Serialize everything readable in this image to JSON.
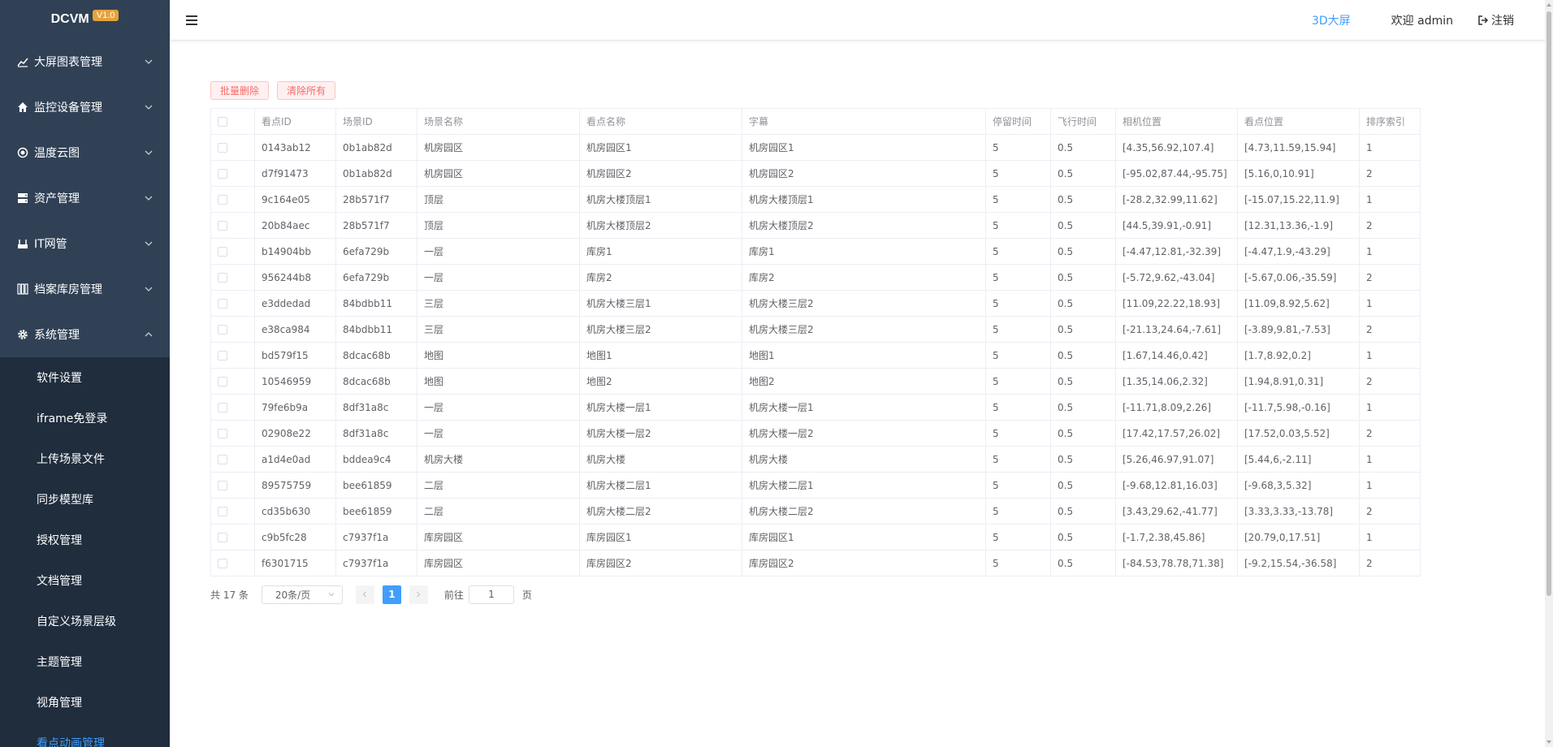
{
  "app": {
    "name": "DCVM",
    "version": "V1.0"
  },
  "sidebar": {
    "menus": [
      {
        "label": "大屏图表管理",
        "icon": "chart-line-icon"
      },
      {
        "label": "监控设备管理",
        "icon": "home-icon"
      },
      {
        "label": "温度云图",
        "icon": "thermometer-icon"
      },
      {
        "label": "资产管理",
        "icon": "server-icon"
      },
      {
        "label": "IT网管",
        "icon": "network-icon"
      },
      {
        "label": "档案库房管理",
        "icon": "archive-icon"
      },
      {
        "label": "系统管理",
        "icon": "gear-icon"
      }
    ],
    "sub_items": [
      {
        "label": "软件设置"
      },
      {
        "label": "iframe免登录"
      },
      {
        "label": "上传场景文件"
      },
      {
        "label": "同步模型库"
      },
      {
        "label": "授权管理"
      },
      {
        "label": "文档管理"
      },
      {
        "label": "自定义场景层级"
      },
      {
        "label": "主题管理"
      },
      {
        "label": "视角管理"
      },
      {
        "label": "看点动画管理"
      }
    ]
  },
  "header": {
    "screen_link": "3D大屏",
    "welcome": "欢迎 admin",
    "logout": "注销"
  },
  "toolbar": {
    "batch_delete": "批量删除",
    "clear_all": "清除所有"
  },
  "table": {
    "columns": [
      "看点ID",
      "场景ID",
      "场景名称",
      "看点名称",
      "字幕",
      "停留时间",
      "飞行时间",
      "相机位置",
      "看点位置",
      "排序索引"
    ],
    "rows": [
      [
        "0143ab12",
        "0b1ab82d",
        "机房园区",
        "机房园区1",
        "机房园区1",
        "5",
        "0.5",
        "[4.35,56.92,107.4]",
        "[4.73,11.59,15.94]",
        "1"
      ],
      [
        "d7f91473",
        "0b1ab82d",
        "机房园区",
        "机房园区2",
        "机房园区2",
        "5",
        "0.5",
        "[-95.02,87.44,-95.75]",
        "[5.16,0,10.91]",
        "2"
      ],
      [
        "9c164e05",
        "28b571f7",
        "顶层",
        "机房大楼顶层1",
        "机房大楼顶层1",
        "5",
        "0.5",
        "[-28.2,32.99,11.62]",
        "[-15.07,15.22,11.9]",
        "1"
      ],
      [
        "20b84aec",
        "28b571f7",
        "顶层",
        "机房大楼顶层2",
        "机房大楼顶层2",
        "5",
        "0.5",
        "[44.5,39.91,-0.91]",
        "[12.31,13.36,-1.9]",
        "2"
      ],
      [
        "b14904bb",
        "6efa729b",
        "一层",
        "库房1",
        "库房1",
        "5",
        "0.5",
        "[-4.47,12.81,-32.39]",
        "[-4.47,1.9,-43.29]",
        "1"
      ],
      [
        "956244b8",
        "6efa729b",
        "一层",
        "库房2",
        "库房2",
        "5",
        "0.5",
        "[-5.72,9.62,-43.04]",
        "[-5.67,0.06,-35.59]",
        "2"
      ],
      [
        "e3ddedad",
        "84bdbb11",
        "三层",
        "机房大楼三层1",
        "机房大楼三层2",
        "5",
        "0.5",
        "[11.09,22.22,18.93]",
        "[11.09,8.92,5.62]",
        "1"
      ],
      [
        "e38ca984",
        "84bdbb11",
        "三层",
        "机房大楼三层2",
        "机房大楼三层2",
        "5",
        "0.5",
        "[-21.13,24.64,-7.61]",
        "[-3.89,9.81,-7.53]",
        "2"
      ],
      [
        "bd579f15",
        "8dcac68b",
        "地图",
        "地图1",
        "地图1",
        "5",
        "0.5",
        "[1.67,14.46,0.42]",
        "[1.7,8.92,0.2]",
        "1"
      ],
      [
        "10546959",
        "8dcac68b",
        "地图",
        "地图2",
        "地图2",
        "5",
        "0.5",
        "[1.35,14.06,2.32]",
        "[1.94,8.91,0.31]",
        "2"
      ],
      [
        "79fe6b9a",
        "8df31a8c",
        "一层",
        "机房大楼一层1",
        "机房大楼一层1",
        "5",
        "0.5",
        "[-11.71,8.09,2.26]",
        "[-11.7,5.98,-0.16]",
        "1"
      ],
      [
        "02908e22",
        "8df31a8c",
        "一层",
        "机房大楼一层2",
        "机房大楼一层2",
        "5",
        "0.5",
        "[17.42,17.57,26.02]",
        "[17.52,0.03,5.52]",
        "2"
      ],
      [
        "a1d4e0ad",
        "bddea9c4",
        "机房大楼",
        "机房大楼",
        "机房大楼",
        "5",
        "0.5",
        "[5.26,46.97,91.07]",
        "[5.44,6,-2.11]",
        "1"
      ],
      [
        "89575759",
        "bee61859",
        "二层",
        "机房大楼二层1",
        "机房大楼二层1",
        "5",
        "0.5",
        "[-9.68,12.81,16.03]",
        "[-9.68,3,5.32]",
        "1"
      ],
      [
        "cd35b630",
        "bee61859",
        "二层",
        "机房大楼二层2",
        "机房大楼二层2",
        "5",
        "0.5",
        "[3.43,29.62,-41.77]",
        "[3.33,3.33,-13.78]",
        "2"
      ],
      [
        "c9b5fc28",
        "c7937f1a",
        "库房园区",
        "库房园区1",
        "库房园区1",
        "5",
        "0.5",
        "[-1.7,2.38,45.86]",
        "[20.79,0,17.51]",
        "1"
      ],
      [
        "f6301715",
        "c7937f1a",
        "库房园区",
        "库房园区2",
        "库房园区2",
        "5",
        "0.5",
        "[-84.53,78.78,71.38]",
        "[-9.2,15.54,-36.58]",
        "2"
      ]
    ]
  },
  "pagination": {
    "total_text": "共 17 条",
    "page_size": "20条/页",
    "current_page": "1",
    "goto_label": "前往",
    "goto_value": "1",
    "page_suffix": "页"
  },
  "colors": {
    "sidebar_bg": "#304156",
    "submenu_bg": "#1f2d3d",
    "accent": "#409eff",
    "danger": "#f56c6c",
    "badge": "#e6a23c"
  }
}
